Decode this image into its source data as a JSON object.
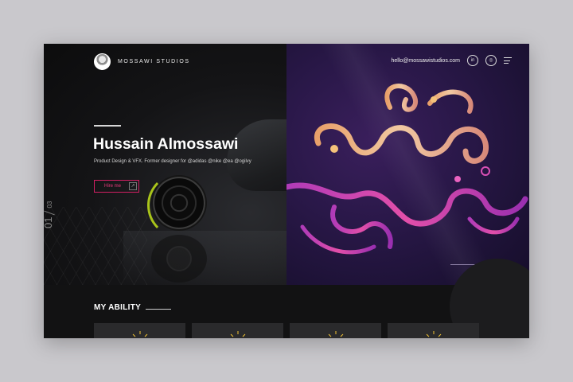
{
  "header": {
    "brand": "MOSSAWI STUDIOS",
    "email": "hello@mossawistudios.com",
    "social": [
      "in",
      "ig"
    ]
  },
  "hero": {
    "title": "Hussain Almossawi",
    "subtitle": "Product Design & VFX. Former designer for @adidas @nike @ea @ogilvy",
    "cta": "Hire me",
    "cta_arrow": "↗",
    "slide_current": "01",
    "slide_total": "03"
  },
  "ability": {
    "title": "MY ABILITY",
    "card_count": 4
  },
  "colors": {
    "accent": "#d21f63",
    "wheel_accent": "#a9c41a",
    "icon_yellow": "#f1c232",
    "purple_bg": "#2a1849"
  }
}
